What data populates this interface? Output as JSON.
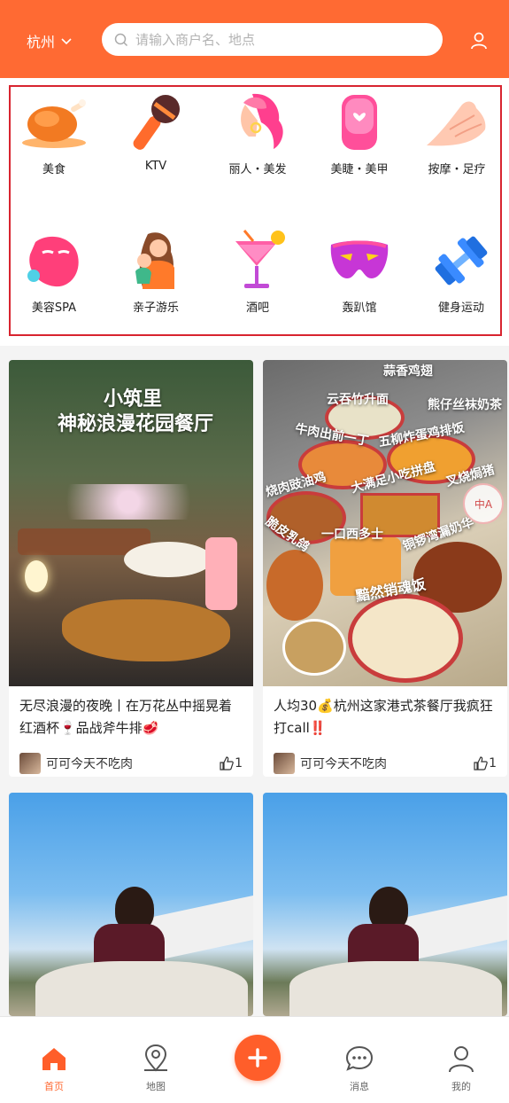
{
  "header": {
    "city": "杭州",
    "search_placeholder": "请输入商户名、地点"
  },
  "categories": [
    {
      "label": "美食",
      "icon": "roast-chicken-icon"
    },
    {
      "label": "KTV",
      "icon": "microphone-icon"
    },
    {
      "label": "丽人・美发",
      "icon": "woman-hair-icon"
    },
    {
      "label": "美睫・美甲",
      "icon": "nail-icon"
    },
    {
      "label": "按摩・足疗",
      "icon": "massage-hand-icon"
    },
    {
      "label": "美容SPA",
      "icon": "face-mask-icon"
    },
    {
      "label": "亲子游乐",
      "icon": "parent-child-icon"
    },
    {
      "label": "酒吧",
      "icon": "cocktail-icon"
    },
    {
      "label": "轰趴馆",
      "icon": "party-mask-icon"
    },
    {
      "label": "健身运动",
      "icon": "dumbbell-icon"
    }
  ],
  "feed": [
    {
      "title": "无尽浪漫的夜晚丨在万花丛中摇晃着红酒杯🍷品战斧牛排🥩",
      "author": "可可今天不吃肉",
      "likes": "1",
      "image_text": [
        "小筑里",
        "神秘浪漫花园餐厅"
      ]
    },
    {
      "title": "人均30💰杭州这家港式茶餐厅我疯狂打call‼️",
      "author": "可可今天不吃肉",
      "likes": "1",
      "image_text": [
        "蒜香鸡翅",
        "云吞竹升面",
        "熊仔丝袜奶茶",
        "牛肉出前一丁",
        "五柳炸蛋鸡排饭",
        "烧肉豉油鸡",
        "大满足小吃拼盘",
        "叉烧焗猪",
        "脆皮乳鸽",
        "一口西多士",
        "铜锣湾漏奶华",
        "黯然销魂饭"
      ]
    },
    {
      "title": "",
      "author": "",
      "likes": "",
      "image_text": []
    },
    {
      "title": "",
      "author": "",
      "likes": "",
      "image_text": []
    }
  ],
  "float_badge": "中A",
  "tabbar": [
    {
      "label": "首页",
      "icon": "home-icon",
      "active": true
    },
    {
      "label": "地图",
      "icon": "map-pin-icon"
    },
    {
      "label": "",
      "icon": "plus-icon"
    },
    {
      "label": "消息",
      "icon": "chat-icon"
    },
    {
      "label": "我的",
      "icon": "user-icon"
    }
  ],
  "colors": {
    "brand": "#ff6a33",
    "highlight_border": "#d8242f"
  }
}
